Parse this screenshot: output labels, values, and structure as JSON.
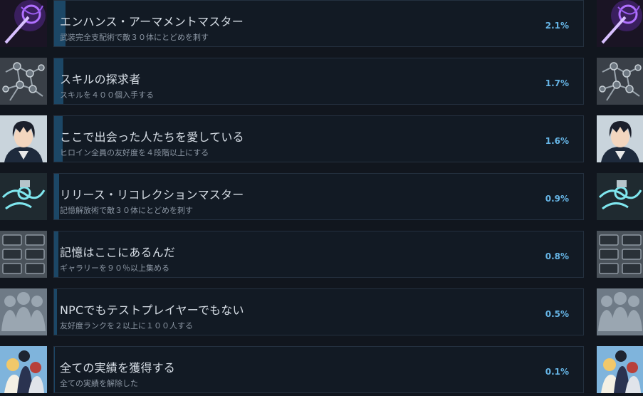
{
  "achievements": [
    {
      "title": "エンハンス・アーマメントマスター",
      "desc": "武装完全支配術で敵３０体にとどめを刺す",
      "percent": "2.1%",
      "rate": 2.1,
      "icon": "purple-sword-icon"
    },
    {
      "title": "スキルの探求者",
      "desc": "スキルを４００個入手する",
      "percent": "1.7%",
      "rate": 1.7,
      "icon": "skill-node-network-icon"
    },
    {
      "title": "ここで出会った人たちを愛している",
      "desc": "ヒロイン全員の友好度を４段階以上にする",
      "percent": "1.6%",
      "rate": 1.6,
      "icon": "kirito-portrait-icon"
    },
    {
      "title": "リリース・リコレクションマスター",
      "desc": "記憶解放術で敵３０体にとどめを刺す",
      "percent": "0.9%",
      "rate": 0.9,
      "icon": "cyan-swirl-icon"
    },
    {
      "title": "記憶はここにあるんだ",
      "desc": "ギャラリーを９０％以上集める",
      "percent": "0.8%",
      "rate": 0.8,
      "icon": "gallery-grid-icon"
    },
    {
      "title": "NPCでもテストプレイヤーでもない",
      "desc": "友好度ランクを２以上に１００人する",
      "percent": "0.5%",
      "rate": 0.5,
      "icon": "crowd-silhouettes-icon"
    },
    {
      "title": "全ての実績を獲得する",
      "desc": "全ての実績を解除した",
      "percent": "0.1%",
      "rate": 0.1,
      "icon": "characters-group-icon"
    }
  ],
  "colors": {
    "progress": "#1c4766",
    "percent": "#66b5e6",
    "panel_border": "#24303f"
  }
}
